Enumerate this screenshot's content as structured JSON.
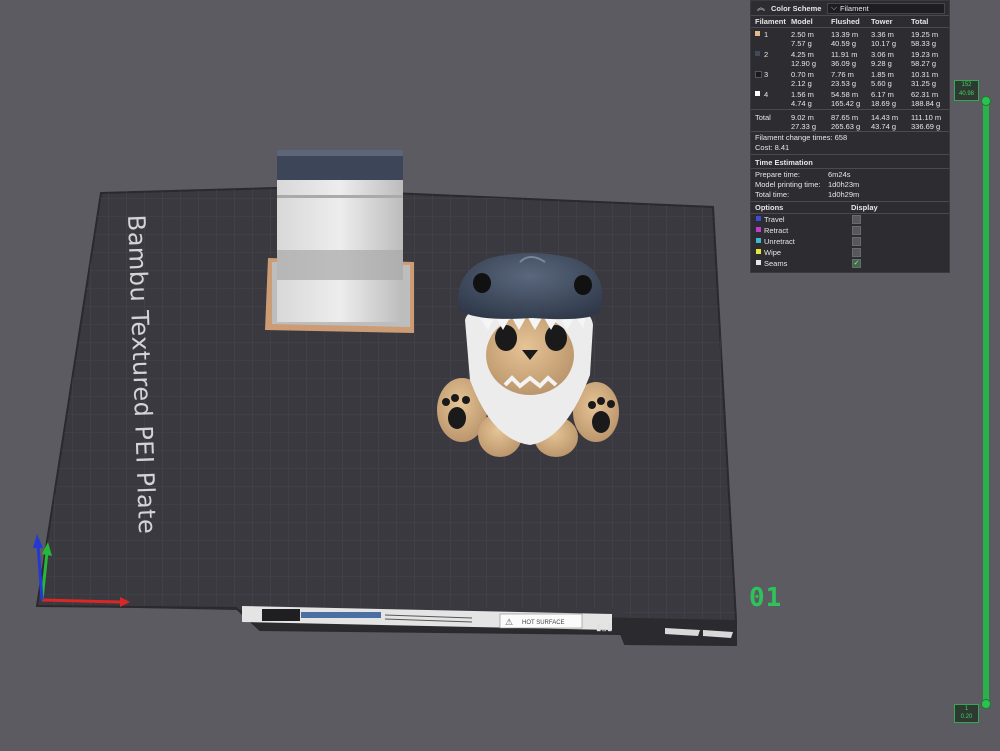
{
  "panel": {
    "header_title": "Color Scheme",
    "scheme_value": "Filament",
    "columns": [
      "Filament",
      "Model",
      "Flushed",
      "Tower",
      "Total"
    ],
    "rows": [
      {
        "id": "1",
        "color": "#e3b98a",
        "model": [
          "2.50 m",
          "7.57 g"
        ],
        "flushed": [
          "13.39 m",
          "40.59 g"
        ],
        "tower": [
          "3.36 m",
          "10.17 g"
        ],
        "total": [
          "19.25 m",
          "58.33 g"
        ]
      },
      {
        "id": "2",
        "color": "#3f4a5c",
        "model": [
          "4.25 m",
          "12.90 g"
        ],
        "flushed": [
          "11.91 m",
          "36.09 g"
        ],
        "tower": [
          "3.06 m",
          "9.28 g"
        ],
        "total": [
          "19.23 m",
          "58.27 g"
        ]
      },
      {
        "id": "3",
        "color": "#1a1a1a",
        "model": [
          "0.70 m",
          "2.12 g"
        ],
        "flushed": [
          "7.76 m",
          "23.53 g"
        ],
        "tower": [
          "1.85 m",
          "5.60 g"
        ],
        "total": [
          "10.31 m",
          "31.25 g"
        ]
      },
      {
        "id": "4",
        "color": "#ffffff",
        "model": [
          "1.56 m",
          "4.74 g"
        ],
        "flushed": [
          "54.58 m",
          "165.42 g"
        ],
        "tower": [
          "6.17 m",
          "18.69 g"
        ],
        "total": [
          "62.31 m",
          "188.84 g"
        ]
      }
    ],
    "total_row": {
      "label": "Total",
      "model": [
        "9.02 m",
        "27.33 g"
      ],
      "flushed": [
        "87.65 m",
        "265.63 g"
      ],
      "tower": [
        "14.43 m",
        "43.74 g"
      ],
      "total": [
        "111.10 m",
        "336.69 g"
      ]
    },
    "change_times": "Filament change times:  658",
    "cost": "Cost:  8.41",
    "time_title": "Time Estimation",
    "prepare_label": "Prepare time:",
    "prepare_value": "6m24s",
    "model_time_label": "Model printing time:",
    "model_time_value": "1d0h23m",
    "total_time_label": "Total time:",
    "total_time_value": "1d0h29m",
    "options_title": "Options",
    "display_title": "Display",
    "options": [
      {
        "label": "Travel",
        "color": "#3d4bd8",
        "checked": false
      },
      {
        "label": "Retract",
        "color": "#c23bd1",
        "checked": false
      },
      {
        "label": "Unretract",
        "color": "#3fb8d0",
        "checked": false
      },
      {
        "label": "Wipe",
        "color": "#e8e23a",
        "checked": false
      },
      {
        "label": "Seams",
        "color": "#e6e6e6",
        "checked": true
      }
    ]
  },
  "slider": {
    "top_layer": "152",
    "top_height": "40.98",
    "bottom_layer": "1",
    "bottom_height": "0.20"
  },
  "plate": {
    "bed_label": "Bambu Textured PEI Plate",
    "plate_number": "01",
    "hot_surface": "HOT SURFACE"
  }
}
